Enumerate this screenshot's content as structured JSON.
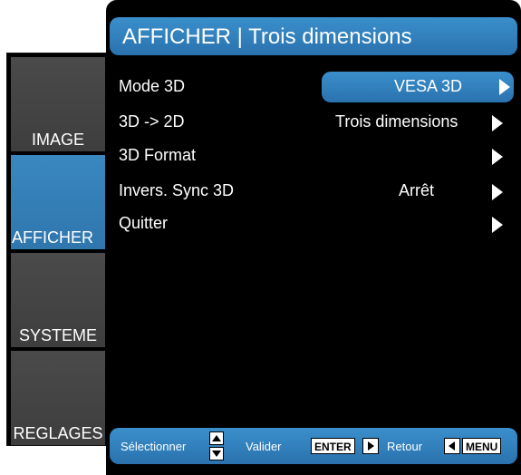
{
  "sidebar": {
    "tabs": [
      {
        "label": "IMAGE"
      },
      {
        "label": "AFFICHER"
      },
      {
        "label": "SYSTEME"
      },
      {
        "label": "REGLAGES"
      }
    ],
    "active": "AFFICHER"
  },
  "header": {
    "title": "AFFICHER | Trois dimensions"
  },
  "menu": {
    "items": [
      {
        "label": "Mode 3D",
        "value": "VESA 3D"
      },
      {
        "label": "3D -> 2D",
        "value": "Trois dimensions"
      },
      {
        "label": "3D Format",
        "value": ""
      },
      {
        "label": "Invers. Sync 3D",
        "value": "Arrêt"
      },
      {
        "label": "Quitter",
        "value": ""
      }
    ]
  },
  "footer": {
    "select_label": "Sélectionner",
    "validate_label": "Valider",
    "enter_key": "ENTER",
    "back_label": "Retour",
    "menu_key": "MENU"
  },
  "colors": {
    "accent": "#2f7fbe",
    "background": "#000000",
    "tab": "#444444"
  }
}
